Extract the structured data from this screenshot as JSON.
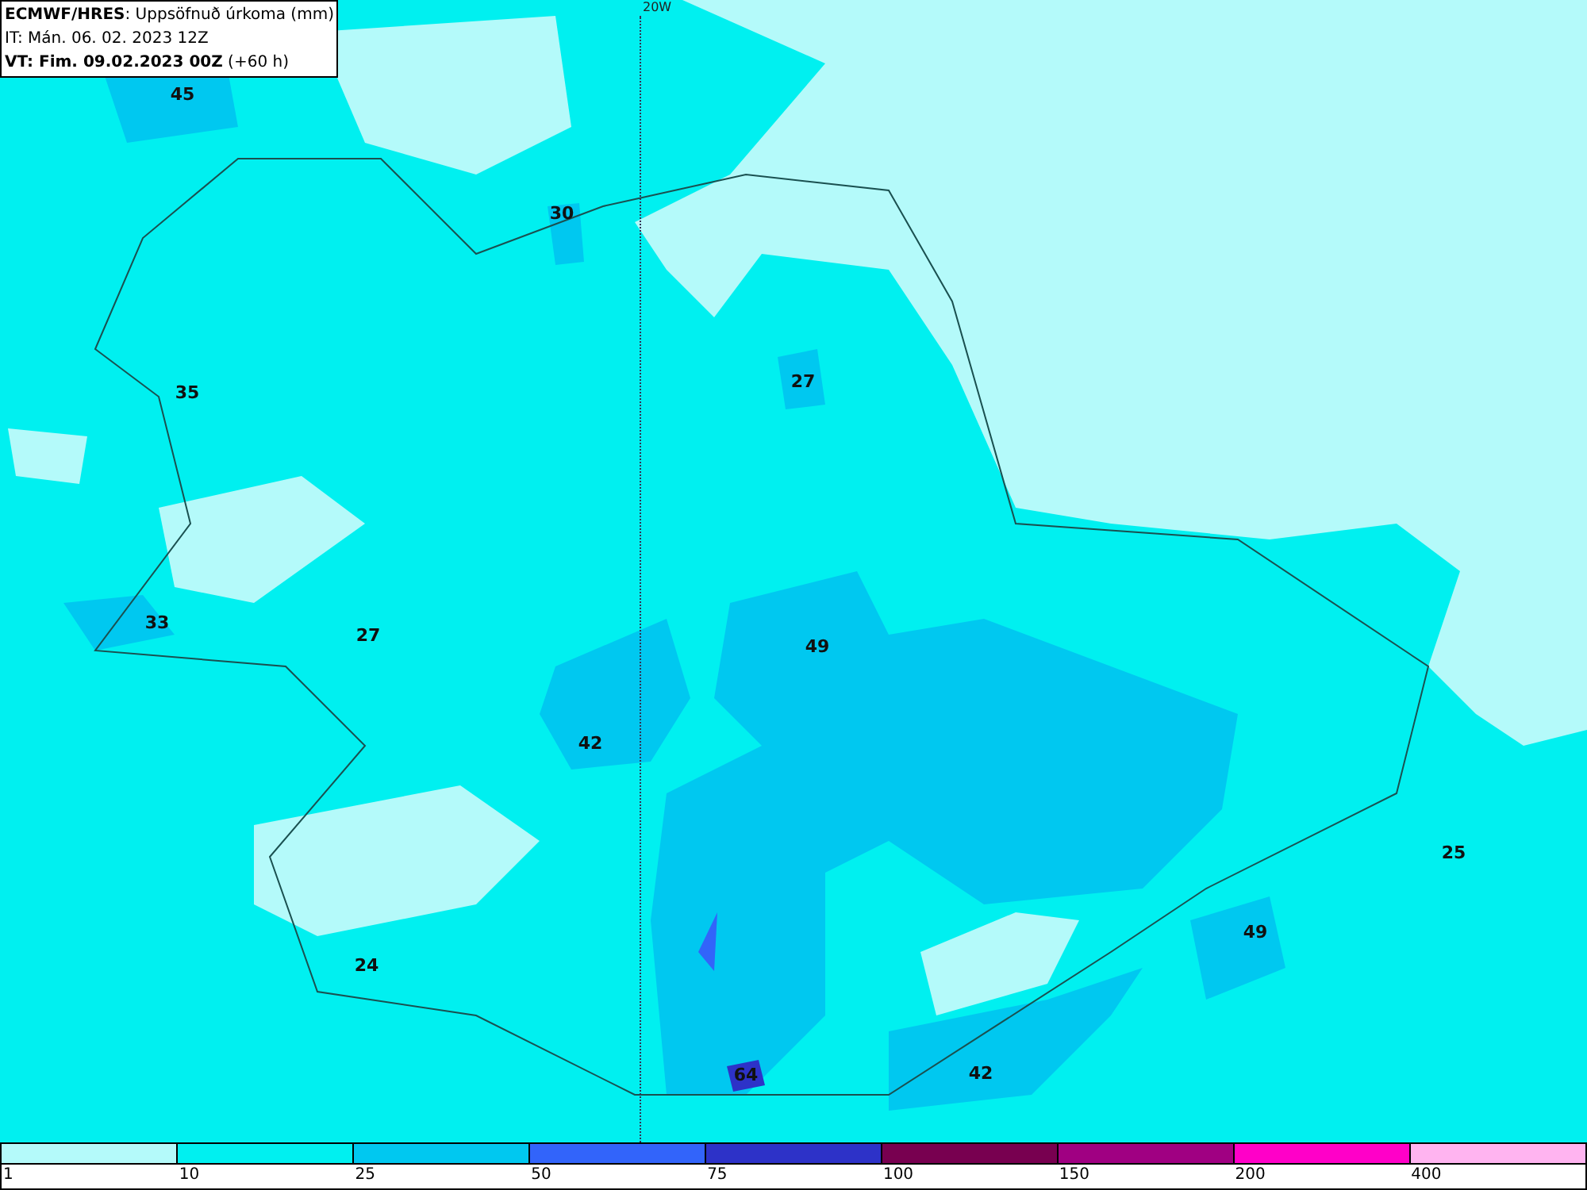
{
  "header": {
    "line_1": "**ECMWF/HRES**: Uppsöfnuð úrkoma (mm)",
    "line_2": "IT: Mán. 06. 02. 2023 12Z",
    "line_3": "**VT: Fim. 09.02.2023 00Z** (+60 h)"
  },
  "meridian_label": "20W",
  "map_values": [
    "45",
    "30",
    "27",
    "35",
    "33",
    "27",
    "49",
    "42",
    "25",
    "49",
    "24",
    "64",
    "42"
  ],
  "legend": {
    "swatches": [
      {
        "color": "#b4fafa"
      },
      {
        "color": "#00f0f0"
      },
      {
        "color": "#00c8f0"
      },
      {
        "color": "#3264fa"
      },
      {
        "color": "#2d32c8"
      },
      {
        "color": "#780050"
      },
      {
        "color": "#a00082"
      },
      {
        "color": "#ff00c8"
      },
      {
        "color": "#ffb4f0"
      }
    ],
    "ticks": [
      "1",
      "10",
      "25",
      "50",
      "75",
      "100",
      "150",
      "200",
      "400"
    ]
  }
}
